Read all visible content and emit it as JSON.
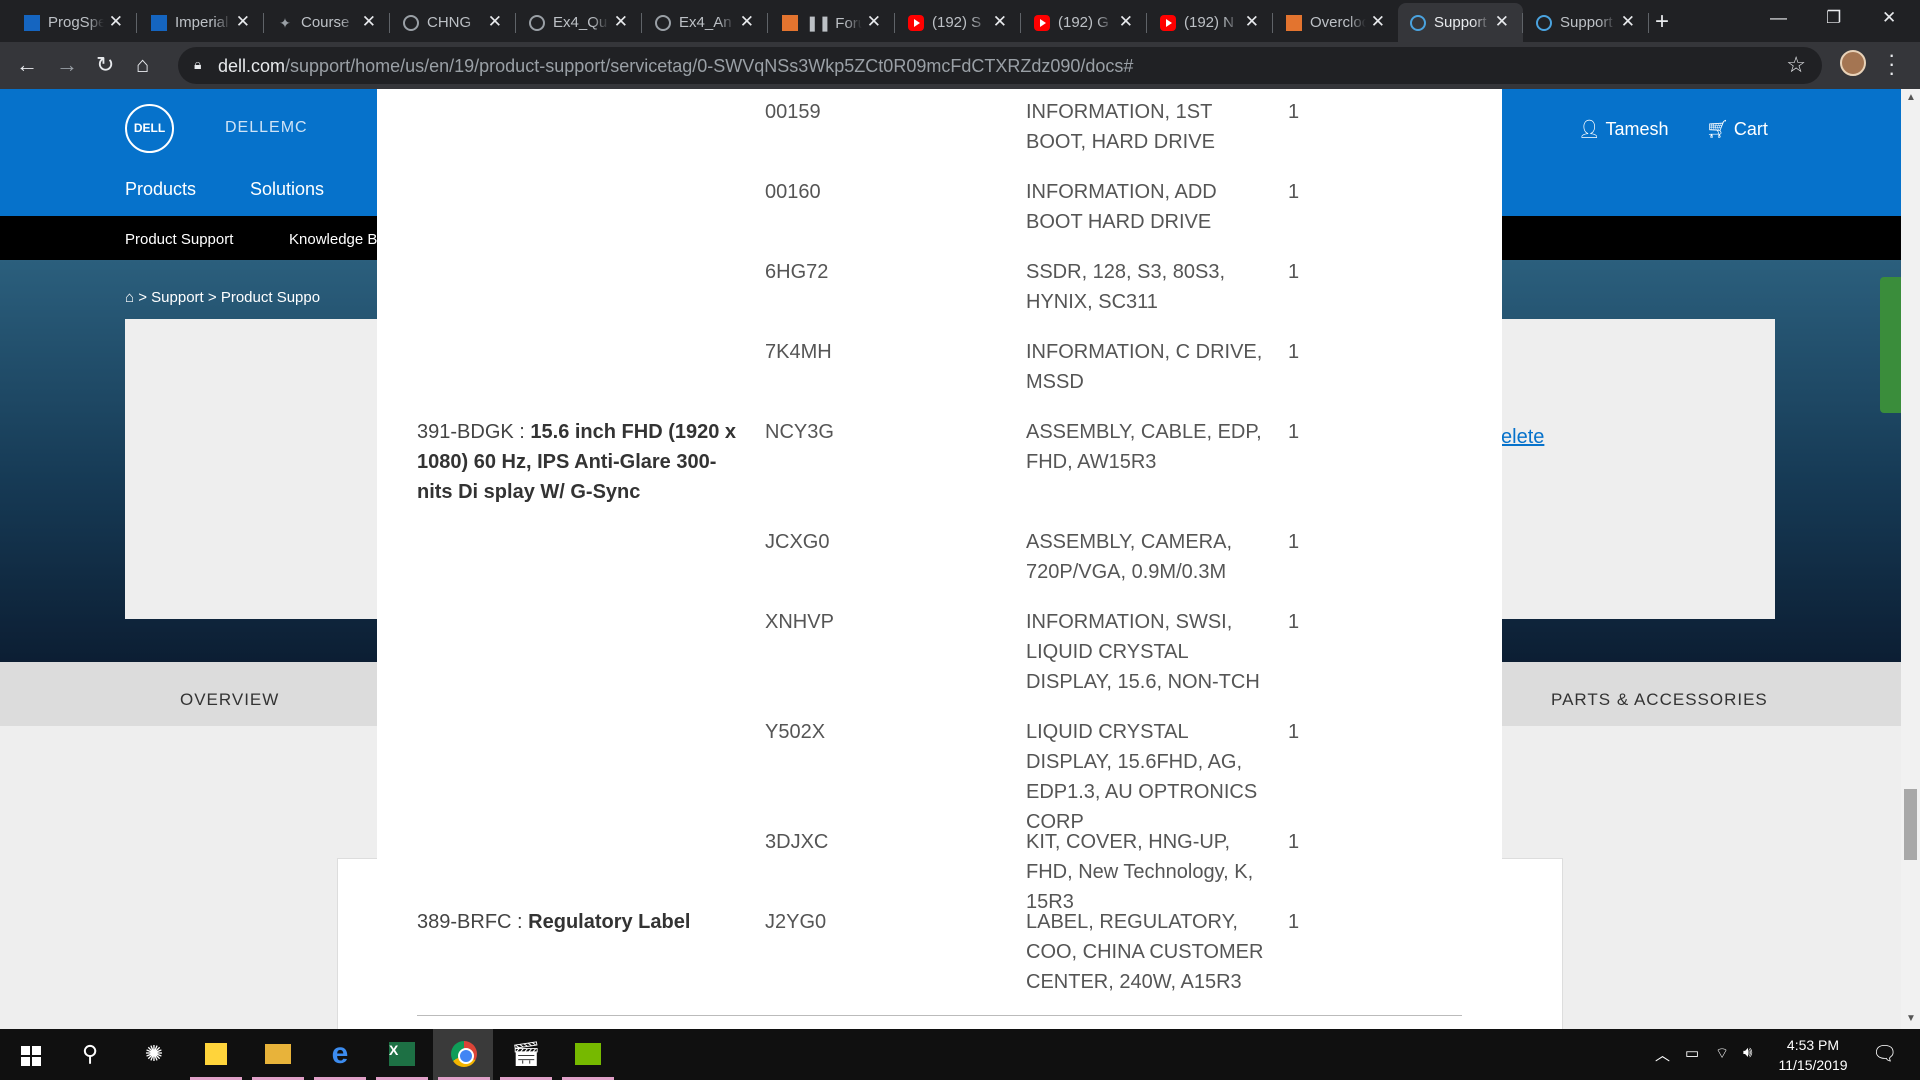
{
  "browser": {
    "tabs": [
      {
        "title": "ProgSpec",
        "icon": "square"
      },
      {
        "title": "Imperial",
        "icon": "square"
      },
      {
        "title": "Course",
        "icon": "bulb"
      },
      {
        "title": "CHNG",
        "icon": "globe"
      },
      {
        "title": "Ex4_Qu",
        "icon": "globe"
      },
      {
        "title": "Ex4_An",
        "icon": "globe"
      },
      {
        "title": "❚❚ Forum",
        "icon": "l"
      },
      {
        "title": "(192) S",
        "icon": "yt"
      },
      {
        "title": "(192) G",
        "icon": "yt"
      },
      {
        "title": "(192) N",
        "icon": "yt"
      },
      {
        "title": "Overclock",
        "icon": "l"
      },
      {
        "title": "Support",
        "icon": "dell"
      },
      {
        "title": "Support",
        "icon": "dell"
      }
    ],
    "active_tab_index": 11,
    "url_host": "dell.com",
    "url_path": "/support/home/us/en/19/product-support/servicetag/0-SWVqNSs3Wkp5ZCt0R09mcFdCTXRZdz090/docs#"
  },
  "dell": {
    "logo_text": "DELL",
    "brand_text": "DELLEMC",
    "nav": [
      "Products",
      "Solutions"
    ],
    "account_name": "Tamesh",
    "cart_label": "Cart",
    "subnav": [
      "Product Support",
      "Knowledge B"
    ],
    "breadcrumb": [
      "Support",
      "Product Suppo"
    ],
    "delete_link": "elete",
    "tabs": [
      "OVERVIEW",
      "PARTS & ACCESSORIES"
    ]
  },
  "parts_rows": [
    {
      "desc_code": "",
      "desc_name": "",
      "part": "00159",
      "part_desc": "INFORMATION, 1ST BOOT, HARD DRIVE",
      "qty": "1"
    },
    {
      "desc_code": "",
      "desc_name": "",
      "part": "00160",
      "part_desc": "INFORMATION, ADD BOOT HARD DRIVE",
      "qty": "1"
    },
    {
      "desc_code": "",
      "desc_name": "",
      "part": "6HG72",
      "part_desc": "SSDR, 128, S3, 80S3, HYNIX, SC311",
      "qty": "1"
    },
    {
      "desc_code": "",
      "desc_name": "",
      "part": "7K4MH",
      "part_desc": "INFORMATION, C DRIVE, MSSD",
      "qty": "1"
    },
    {
      "desc_code": "391-BDGK : ",
      "desc_name": "15.6 inch FHD (1920 x 1080) 60 Hz, IPS Anti-Glare 300-nits Di splay W/ G-Sync",
      "part": "NCY3G",
      "part_desc": "ASSEMBLY, CABLE, EDP, FHD, AW15R3",
      "qty": "1"
    },
    {
      "desc_code": "",
      "desc_name": "",
      "part": "JCXG0",
      "part_desc": "ASSEMBLY, CAMERA, 720P/VGA, 0.9M/0.3M",
      "qty": "1"
    },
    {
      "desc_code": "",
      "desc_name": "",
      "part": "XNHVP",
      "part_desc": "INFORMATION, SWSI, LIQUID CRYSTAL DISPLAY, 15.6, NON-TCH",
      "qty": "1"
    },
    {
      "desc_code": "",
      "desc_name": "",
      "part": "Y502X",
      "part_desc": "LIQUID CRYSTAL DISPLAY, 15.6FHD, AG, EDP1.3, AU OPTRONICS CORP",
      "qty": "1"
    },
    {
      "desc_code": "",
      "desc_name": "",
      "part": "3DJXC",
      "part_desc": "KIT, COVER, HNG-UP, FHD, New Technology, K, 15R3",
      "qty": "1"
    },
    {
      "desc_code": "389-BRFC : ",
      "desc_name": "Regulatory Label",
      "part": "J2YG0",
      "part_desc": "LABEL, REGULATORY, COO, CHINA CUSTOMER CENTER, 240W, A15R3",
      "qty": "1"
    }
  ],
  "taskbar": {
    "time": "4:53 PM",
    "date": "11/15/2019"
  },
  "colors": {
    "dell_blue": "#0672cb",
    "chrome_dark": "#202124",
    "taskbar": "#101010"
  }
}
